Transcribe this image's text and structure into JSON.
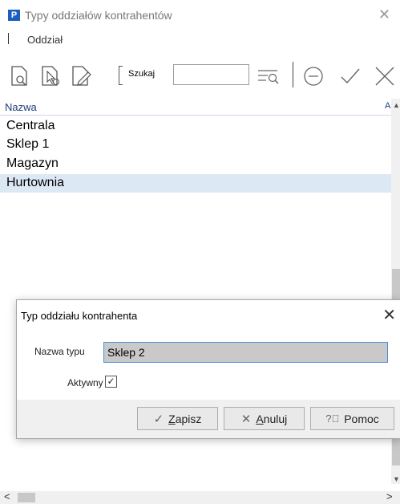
{
  "window": {
    "title": "Typy oddziałów kontrahentów",
    "app_icon_letter": "P",
    "close_icon": "close-icon"
  },
  "menu": {
    "item": "Oddział"
  },
  "toolbar": {
    "icons": [
      "document-search-icon",
      "document-pointer-icon",
      "document-edit-icon",
      "filter-list-icon",
      "minus-circle-icon",
      "check-icon",
      "close-icon"
    ],
    "search_label": "Szukaj",
    "search_value": ""
  },
  "grid": {
    "column_header": "Nazwa",
    "column_header_extra": "A",
    "rows": [
      "Centrala",
      "Sklep 1",
      "Magazyn",
      "Hurtownia"
    ],
    "selected_row": 3
  },
  "dialog": {
    "title": "Typ oddziału kontrahenta",
    "nazwa_label": "Nazwa typu",
    "nazwa_value": "Sklep 2",
    "aktywny_label": "Aktywny",
    "aktywny_checked": true,
    "buttons": {
      "save_prefix": "",
      "save_mnemonic": "Z",
      "save_rest": "apisz",
      "cancel_mnemonic": "A",
      "cancel_rest": "nuluj",
      "help": "Pomoc"
    }
  },
  "colors": {
    "selected_row_bg": "#dde8f5",
    "input_focus_border": "#4a90d9",
    "brand": "#1d5fbf"
  }
}
